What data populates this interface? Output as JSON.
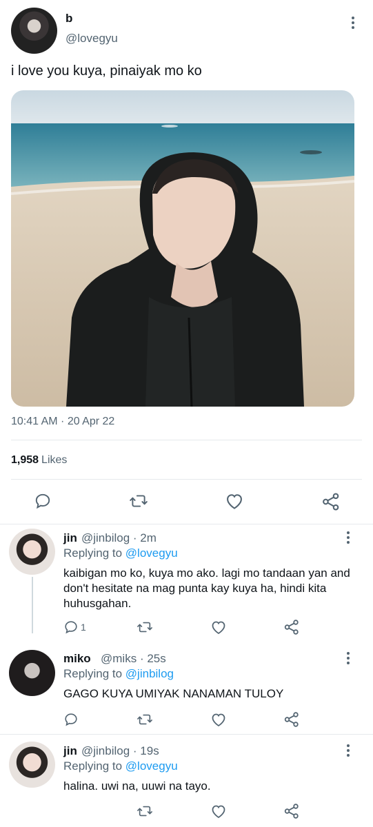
{
  "tweet": {
    "display_name": "b",
    "handle": "@lovegyu",
    "text": "i love you kuya, pinaiyak mo ko",
    "timestamp": "10:41 AM · 20 Apr 22",
    "likes_count": "1,958",
    "likes_label": "Likes"
  },
  "replies": [
    {
      "display_name": "jin",
      "handle": "@jinbilog",
      "time": "· 2m",
      "replying_to_label": "Replying to",
      "replying_to": "@lovegyu",
      "text": "kaibigan mo ko, kuya mo ako. lagi mo tandaan yan and don't hesitate na mag punta kay kuya ha, hindi kita huhusgahan.",
      "reply_count": "1"
    },
    {
      "display_name": "miko",
      "handle": "@miks",
      "time": "· 25s",
      "replying_to_label": "Replying to",
      "replying_to": "@jinbilog",
      "text": "GAGO KUYA UMIYAK NANAMAN TULOY"
    },
    {
      "display_name": "jin",
      "handle": "@jinbilog",
      "time": "· 19s",
      "replying_to_label": "Replying to",
      "replying_to": "@lovegyu",
      "text": "halina. uwi na, uuwi na tayo."
    }
  ],
  "icons": {
    "reply": "reply-icon",
    "retweet": "retweet-icon",
    "like": "heart-icon",
    "share": "share-icon",
    "more": "more-vertical-icon"
  },
  "colors": {
    "text": "#0f1419",
    "secondary": "#536471",
    "link": "#1d9bf0",
    "divider": "#e6e9ec"
  }
}
